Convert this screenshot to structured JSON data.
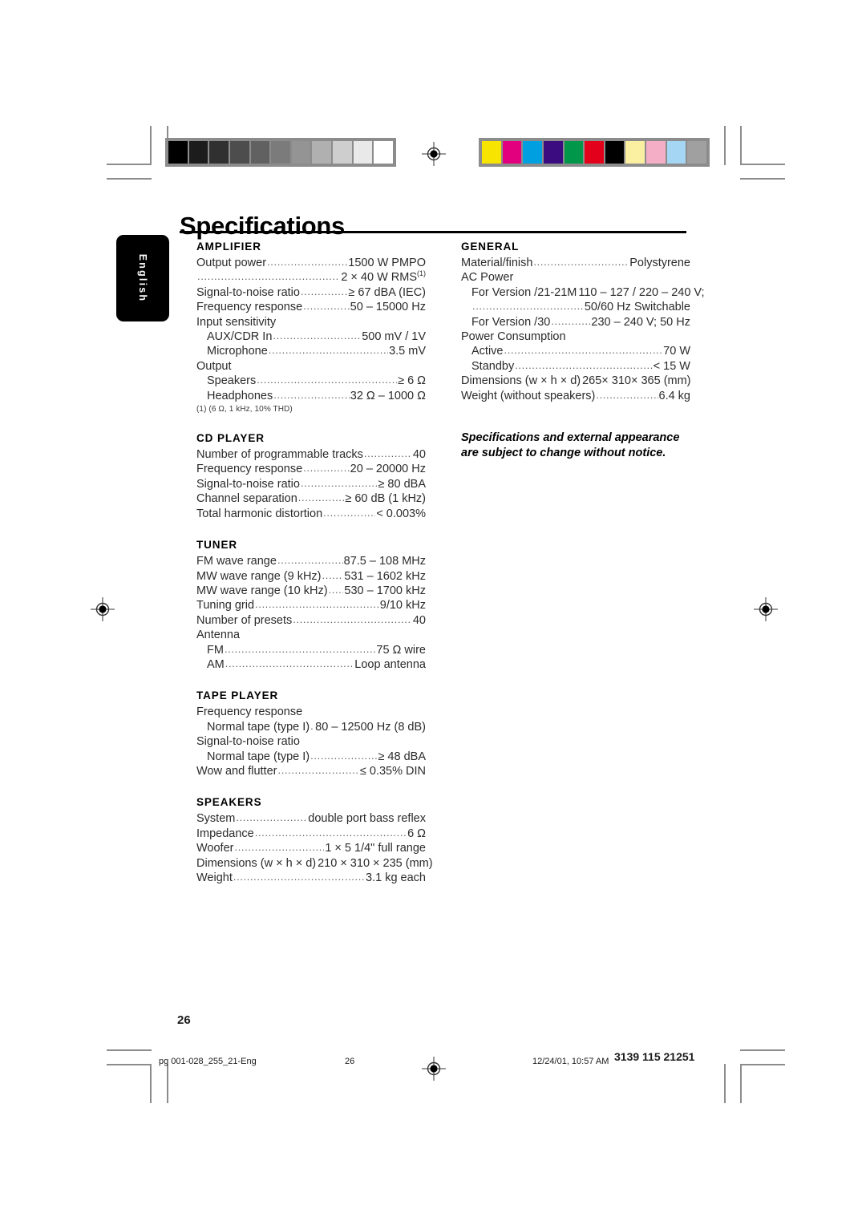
{
  "page": {
    "title": "Specifications",
    "language_tab": "English",
    "page_number": "26"
  },
  "calibration": {
    "grayscale_label": "grayscale-bar",
    "grayscale": [
      "#000000",
      "#1c1c1c",
      "#303030",
      "#4d4d4d",
      "#616161",
      "#7b7b7b",
      "#949494",
      "#b0b0b0",
      "#cecece",
      "#e9e9e9",
      "#ffffff"
    ],
    "color_label": "color-bar",
    "colors": [
      "#f7e400",
      "#e2007e",
      "#00a0e0",
      "#3b0b80",
      "#00974a",
      "#e3001b",
      "#000000",
      "#fbf0a2",
      "#f4aec6",
      "#a5d7f4",
      "#a0a0a0"
    ]
  },
  "left_column": [
    {
      "heading": "AMPLIFIER",
      "rows": [
        {
          "label": "Output power",
          "value": "1500 W PMPO",
          "dots": true,
          "indent": false
        },
        {
          "label": "",
          "value": "2 × 40 W RMS",
          "sup": "(1)",
          "dots": true,
          "indent": false
        },
        {
          "label": "Signal-to-noise ratio",
          "value": "≥ 67 dBA (IEC)",
          "dots": true,
          "indent": false
        },
        {
          "label": "Frequency response",
          "value": "50 – 15000 Hz",
          "dots": true,
          "indent": false
        },
        {
          "label": "Input sensitivity",
          "value": "",
          "dots": false,
          "indent": false
        },
        {
          "label": "AUX/CDR In",
          "value": "500 mV / 1V",
          "dots": true,
          "indent": true
        },
        {
          "label": "Microphone",
          "value": "3.5 mV",
          "dots": true,
          "indent": true
        },
        {
          "label": "Output",
          "value": "",
          "dots": false,
          "indent": false
        },
        {
          "label": "Speakers",
          "value": "≥ 6 Ω",
          "dots": true,
          "indent": true
        },
        {
          "label": "Headphones",
          "value": "32 Ω – 1000 Ω",
          "dots": true,
          "indent": true
        }
      ],
      "footnote": "(1) (6 Ω, 1 kHz, 10% THD)"
    },
    {
      "heading": "CD PLAYER",
      "rows": [
        {
          "label": "Number of programmable tracks",
          "value": "40",
          "dots": true,
          "indent": false
        },
        {
          "label": "Frequency response",
          "value": "20 – 20000 Hz",
          "dots": true,
          "indent": false
        },
        {
          "label": "Signal-to-noise ratio",
          "value": "≥ 80 dBA",
          "dots": true,
          "indent": false
        },
        {
          "label": "Channel separation",
          "value": "≥ 60 dB (1 kHz)",
          "dots": true,
          "indent": false
        },
        {
          "label": "Total harmonic distortion",
          "value": "< 0.003%",
          "dots": true,
          "indent": false
        }
      ]
    },
    {
      "heading": "TUNER",
      "rows": [
        {
          "label": "FM wave range",
          "value": "87.5 – 108 MHz",
          "dots": true,
          "indent": false
        },
        {
          "label": "MW wave range (9 kHz)",
          "value": "531 – 1602 kHz",
          "dots": true,
          "indent": false
        },
        {
          "label": "MW wave range (10 kHz)",
          "value": "530 – 1700 kHz",
          "dots": true,
          "indent": false
        },
        {
          "label": "Tuning grid",
          "value": "9/10 kHz",
          "dots": true,
          "indent": false
        },
        {
          "label": "Number of presets",
          "value": "40",
          "dots": true,
          "indent": false
        },
        {
          "label": "Antenna",
          "value": "",
          "dots": false,
          "indent": false
        },
        {
          "label": "FM",
          "value": "75 Ω wire",
          "dots": true,
          "indent": true
        },
        {
          "label": "AM",
          "value": "Loop antenna",
          "dots": true,
          "indent": true
        }
      ]
    },
    {
      "heading": "TAPE PLAYER",
      "rows": [
        {
          "label": "Frequency response",
          "value": "",
          "dots": false,
          "indent": false
        },
        {
          "label": "Normal tape (type I)",
          "value": "80 – 12500 Hz (8 dB)",
          "dots": true,
          "indent": true
        },
        {
          "label": "Signal-to-noise ratio",
          "value": "",
          "dots": false,
          "indent": false
        },
        {
          "label": "Normal tape (type I)",
          "value": "≥ 48 dBA",
          "dots": true,
          "indent": true
        },
        {
          "label": "Wow and flutter",
          "value": "≤ 0.35% DIN",
          "dots": true,
          "indent": false
        }
      ]
    },
    {
      "heading": "SPEAKERS",
      "rows": [
        {
          "label": "System",
          "value": "double port bass reflex",
          "dots": true,
          "indent": false
        },
        {
          "label": "Impedance",
          "value": "6 Ω",
          "dots": true,
          "indent": false
        },
        {
          "label": "Woofer",
          "value": "1 × 5 1/4\" full range",
          "dots": true,
          "indent": false
        },
        {
          "label": "Dimensions (w × h × d)",
          "value": "210 × 310 × 235 (mm)",
          "dots": true,
          "indent": false
        },
        {
          "label": "Weight",
          "value": "3.1 kg each",
          "dots": true,
          "indent": false
        }
      ]
    }
  ],
  "right_column": [
    {
      "heading": "GENERAL",
      "rows": [
        {
          "label": "Material/finish",
          "value": "Polystyrene",
          "dots": true,
          "indent": false
        },
        {
          "label": "AC Power",
          "value": "",
          "dots": false,
          "indent": false
        },
        {
          "label": "For Version /21-21M",
          "value": "110 – 127 / 220 – 240 V;",
          "dots": true,
          "indent": true
        },
        {
          "label": "",
          "value": "50/60 Hz Switchable",
          "dots": true,
          "indent": true
        },
        {
          "label": "For Version /30",
          "value": "230 – 240 V; 50 Hz",
          "dots": true,
          "indent": true
        },
        {
          "label": "Power Consumption",
          "value": "",
          "dots": false,
          "indent": false
        },
        {
          "label": "Active",
          "value": "70 W",
          "dots": true,
          "indent": true
        },
        {
          "label": "Standby",
          "value": "< 15 W",
          "dots": true,
          "indent": true
        },
        {
          "label": "Dimensions (w × h × d)",
          "value": "265× 310× 365 (mm)",
          "dots": true,
          "indent": false
        },
        {
          "label": "Weight (without speakers)",
          "value": "6.4 kg",
          "dots": true,
          "indent": false
        }
      ]
    }
  ],
  "notice": "Specifications and external appearance are subject to change without notice.",
  "footer": {
    "file": "pg 001-028_255_21-Eng",
    "page": "26",
    "timestamp": "12/24/01, 10:57 AM",
    "doc_code": "3139 115 21251"
  }
}
